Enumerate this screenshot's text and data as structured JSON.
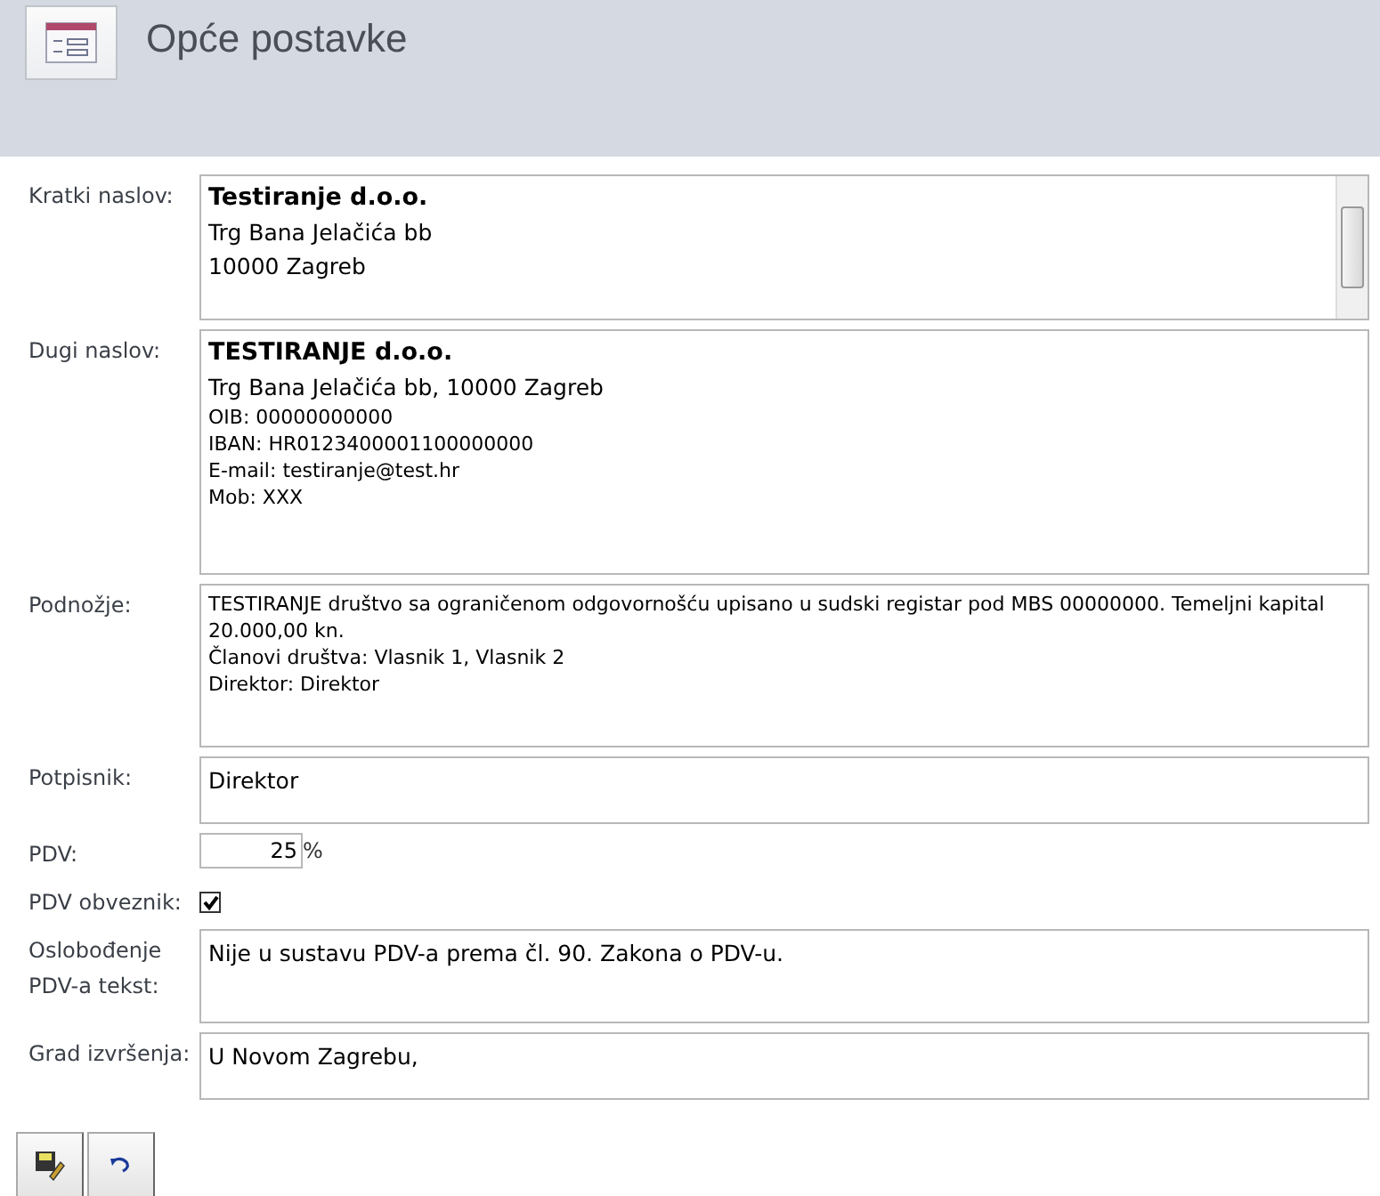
{
  "header": {
    "title": "Opće postavke"
  },
  "fields": [
    {
      "kind": "text",
      "label": "Kratki naslov:",
      "scrollbar": true,
      "lines": [
        {
          "text": "Testiranje d.o.o.",
          "kind": "bold"
        },
        {
          "text": "Trg Bana Jelačića bb",
          "kind": "normal"
        },
        {
          "text": "10000 Zagreb",
          "kind": "normal"
        }
      ]
    },
    {
      "kind": "text",
      "label": "Dugi naslov:",
      "lines": [
        {
          "text": "TESTIRANJE d.o.o.",
          "kind": "bold"
        },
        {
          "text": "Trg Bana Jelačića bb, 10000 Zagreb",
          "kind": "normal"
        },
        {
          "text": "OIB: 00000000000",
          "kind": "small"
        },
        {
          "text": "IBAN: HR0123400001100000000",
          "kind": "small"
        },
        {
          "text": "E-mail: testiranje@test.hr",
          "kind": "small"
        },
        {
          "text": "Mob: XXX",
          "kind": "small"
        }
      ]
    },
    {
      "kind": "text",
      "label": "Podnožje:",
      "lines": [
        {
          "text": "TESTIRANJE društvo sa ograničenom odgovornošću upisano u sudski registar pod MBS 00000000. Temeljni kapital 20.000,00 kn.",
          "kind": "small"
        },
        {
          "text": "Članovi društva: Vlasnik 1, Vlasnik 2",
          "kind": "small"
        },
        {
          "text": "Direktor: Direktor",
          "kind": "small"
        }
      ]
    },
    {
      "kind": "text",
      "label": "Potpisnik:",
      "lines": [
        {
          "text": "Direktor",
          "kind": "normal"
        }
      ]
    },
    {
      "kind": "number",
      "label": "PDV:",
      "value": "25",
      "unit": "%"
    },
    {
      "kind": "checkbox",
      "label": "PDV obveznik:",
      "checked": true
    },
    {
      "kind": "text",
      "label": "Oslobođenje PDV-a tekst:",
      "lines": [
        {
          "text": "Nije u sustavu PDV-a prema čl. 90. Zakona o PDV-u.",
          "kind": "normal"
        }
      ]
    },
    {
      "kind": "text",
      "label": "Grad izvršenja:",
      "lines": [
        {
          "text": "U Novom Zagrebu,",
          "kind": "normal"
        }
      ]
    }
  ],
  "buttons": [
    {
      "kind": "save"
    },
    {
      "kind": "undo"
    }
  ]
}
